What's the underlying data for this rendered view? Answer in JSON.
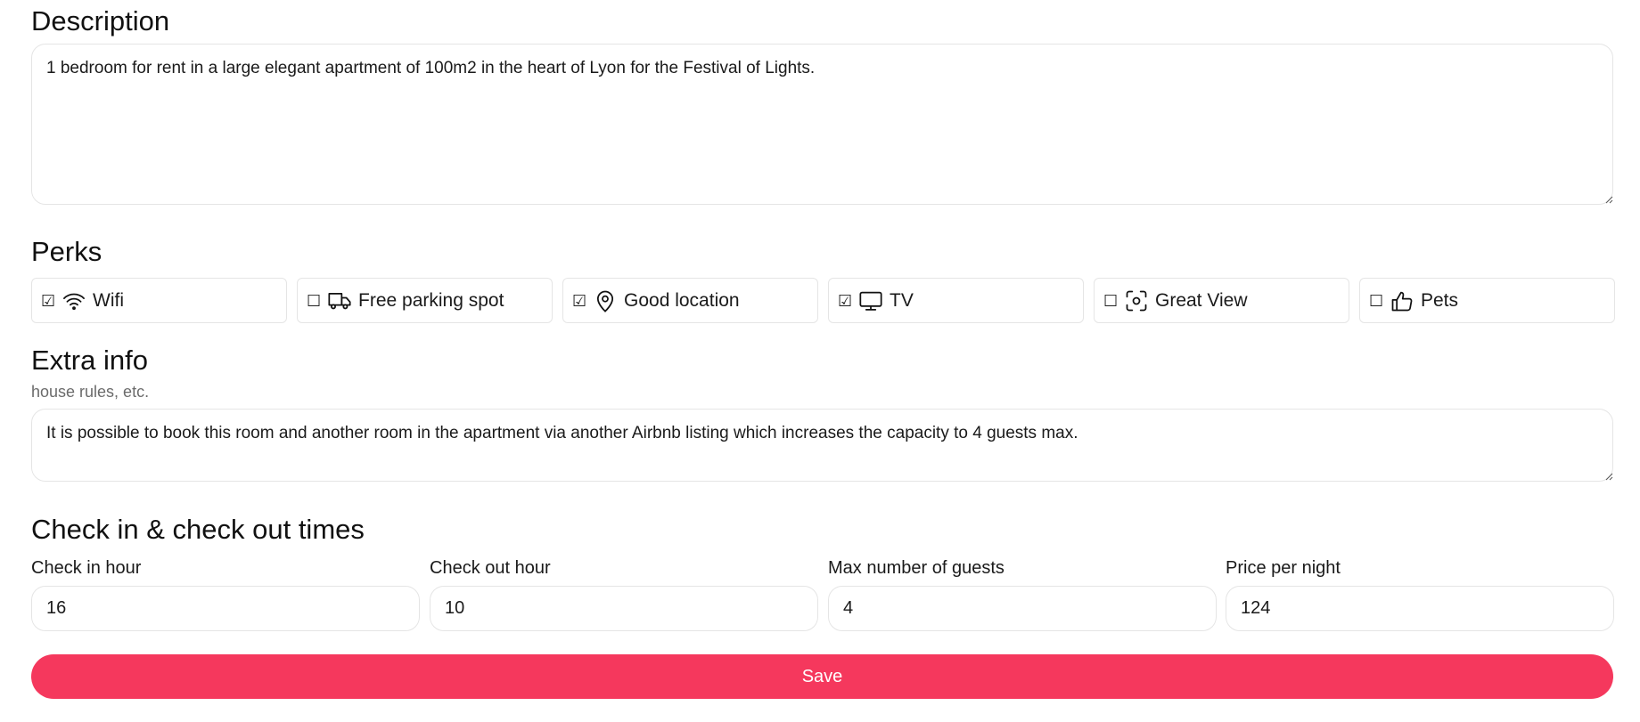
{
  "description": {
    "title": "Description",
    "value": "1 bedroom for rent in a large elegant apartment of 100m2 in the heart of Lyon for the Festival of Lights."
  },
  "perks": {
    "title": "Perks",
    "items": [
      {
        "label": "Wifi",
        "checked": true,
        "checkbox": "☑",
        "icon": "wifi-icon"
      },
      {
        "label": "Free parking spot",
        "checked": false,
        "checkbox": "☐",
        "icon": "truck-icon"
      },
      {
        "label": "Good location",
        "checked": true,
        "checkbox": "☑",
        "icon": "map-pin-icon"
      },
      {
        "label": "TV",
        "checked": true,
        "checkbox": "☑",
        "icon": "monitor-icon"
      },
      {
        "label": "Great View",
        "checked": false,
        "checkbox": "☐",
        "icon": "viewfinder-icon"
      },
      {
        "label": "Pets",
        "checked": false,
        "checkbox": "☐",
        "icon": "thumbs-up-icon"
      }
    ]
  },
  "extra_info": {
    "title": "Extra info",
    "subtitle": "house rules, etc.",
    "value": "It is possible to book this room and another room in the apartment via another Airbnb listing which increases the capacity to 4 guests max."
  },
  "times": {
    "title": "Check in & check out times",
    "fields": [
      {
        "label": "Check in hour",
        "value": "16"
      },
      {
        "label": "Check out hour",
        "value": "10"
      },
      {
        "label": "Max number of guests",
        "value": "4"
      },
      {
        "label": "Price per night",
        "value": "124"
      }
    ]
  },
  "save_label": "Save",
  "colors": {
    "accent": "#f5385d",
    "border": "#e5e5e5",
    "muted": "#6b6b6b"
  }
}
